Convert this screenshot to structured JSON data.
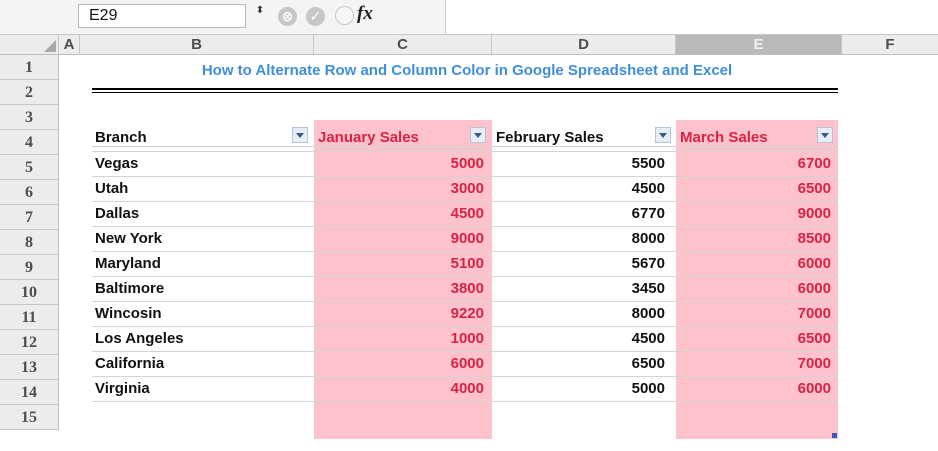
{
  "formula_bar": {
    "name_box": "E29",
    "stepper": "⬍",
    "cancel_icon": "⊗",
    "confirm_icon": "✓",
    "fx_label": "fx"
  },
  "columns": [
    "A",
    "B",
    "C",
    "D",
    "E",
    "F"
  ],
  "selected_column": "E",
  "row_numbers": [
    "1",
    "2",
    "3",
    "4",
    "5",
    "6",
    "7",
    "8",
    "9",
    "10",
    "11",
    "12",
    "13",
    "14",
    "15"
  ],
  "sheet": {
    "title": "How to Alternate Row and Column Color in Google Spreadsheet and Excel",
    "headers": {
      "branch": "Branch",
      "january": "January Sales",
      "february": "February Sales",
      "march": "March Sales"
    },
    "rows": [
      {
        "branch": "Vegas",
        "january": "5000",
        "february": "5500",
        "march": "6700"
      },
      {
        "branch": "Utah",
        "january": "3000",
        "february": "4500",
        "march": "6500"
      },
      {
        "branch": "Dallas",
        "january": "4500",
        "february": "6770",
        "march": "9000"
      },
      {
        "branch": "New York",
        "january": "9000",
        "february": "8000",
        "march": "8500"
      },
      {
        "branch": "Maryland",
        "january": "5100",
        "february": "5670",
        "march": "6000"
      },
      {
        "branch": "Baltimore",
        "january": "3800",
        "february": "3450",
        "march": "6000"
      },
      {
        "branch": "Wincosin",
        "january": "9220",
        "february": "8000",
        "march": "7000"
      },
      {
        "branch": "Los Angeles",
        "january": "1000",
        "february": "4500",
        "march": "6500"
      },
      {
        "branch": "California",
        "january": "6000",
        "february": "6500",
        "march": "7000"
      },
      {
        "branch": "Virginia",
        "january": "4000",
        "february": "5000",
        "march": "6000"
      }
    ]
  },
  "colors": {
    "highlight_fill": "#fec2cc",
    "highlight_text": "#d92344",
    "title_text": "#3e8edc"
  }
}
